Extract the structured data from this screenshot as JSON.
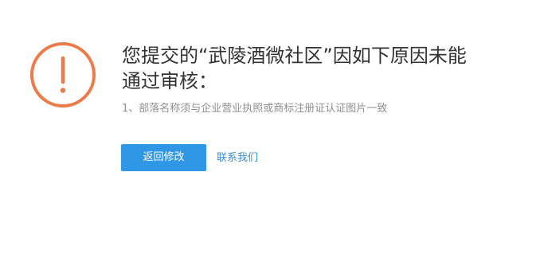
{
  "review": {
    "title": "您提交的“武陵酒微社区”因如下原因未能\n通过审核：",
    "reasons": [
      "1、部落名称须与企业营业执照或商标注册证认证图片一致"
    ]
  },
  "actions": {
    "back_label": "返回修改",
    "contact_label": "联系我们"
  },
  "icon": {
    "name": "exclamation-circle-icon",
    "color": "#ed7b4a"
  },
  "colors": {
    "primary_button": "#3097e6",
    "link": "#3a8fd8",
    "reason_text": "#8f8f8f",
    "title_text": "#333333"
  }
}
